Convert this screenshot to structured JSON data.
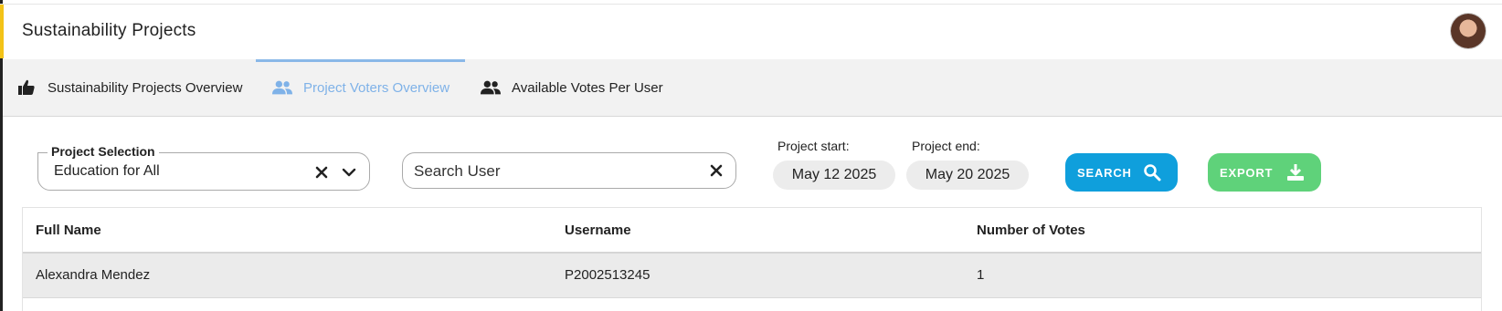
{
  "app": {
    "title": "Sustainability Projects"
  },
  "tabs": [
    {
      "label": "Sustainability Projects Overview",
      "icon": "thumbs-up-icon",
      "active": false
    },
    {
      "label": "Project Voters Overview",
      "icon": "users-icon",
      "active": true
    },
    {
      "label": "Available Votes Per User",
      "icon": "users-icon",
      "active": false
    }
  ],
  "filters": {
    "project_selection": {
      "label": "Project Selection",
      "value": "Education for All"
    },
    "search_user": {
      "placeholder": "Search User",
      "value": ""
    },
    "project_start": {
      "label": "Project start:",
      "value": "May 12 2025"
    },
    "project_end": {
      "label": "Project end:",
      "value": "May 20 2025"
    },
    "search_button": "SEARCH",
    "export_button": "EXPORT"
  },
  "table": {
    "columns": [
      "Full Name",
      "Username",
      "Number of Votes"
    ],
    "rows": [
      {
        "full_name": "Alexandra Mendez",
        "username": "P2002513245",
        "votes": "1"
      }
    ]
  },
  "colors": {
    "accent_bar": "#f3c318",
    "active_tab": "#7fb2e8",
    "search_button": "#0f9fdc",
    "export_button": "#5fd27a"
  }
}
